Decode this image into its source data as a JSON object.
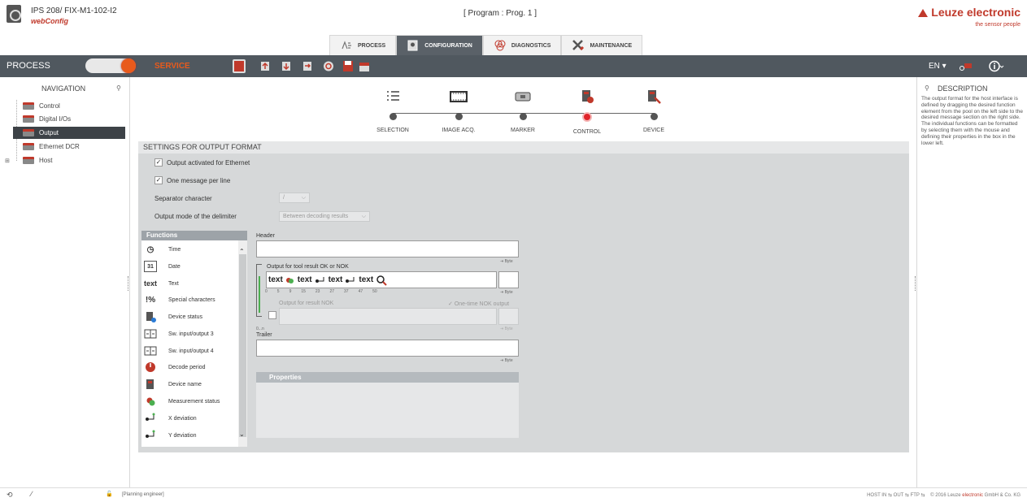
{
  "header": {
    "device_title": "IPS 208/ FIX-M1-102-I2",
    "app_name": "webConfig",
    "program": "[ Program : Prog. 1 ]",
    "brand": "Leuze electronic",
    "tagline": "the sensor people"
  },
  "tabs": [
    {
      "label": "PROCESS",
      "icon": "process-icon"
    },
    {
      "label": "CONFIGURATION",
      "icon": "configuration-icon",
      "active": true
    },
    {
      "label": "DIAGNOSTICS",
      "icon": "diagnostics-icon"
    },
    {
      "label": "MAINTENANCE",
      "icon": "maintenance-icon"
    }
  ],
  "toolbar": {
    "process_label": "PROCESS",
    "service_label": "SERVICE",
    "language": "EN",
    "accent": "#e85a1c"
  },
  "navigation": {
    "title": "NAVIGATION",
    "items": [
      {
        "label": "Control"
      },
      {
        "label": "Digital I/Os"
      },
      {
        "label": "Output",
        "selected": true
      },
      {
        "label": "Ethernet DCR"
      },
      {
        "label": "Host"
      }
    ]
  },
  "steps": [
    {
      "label": "SELECTION",
      "icon": "list-icon"
    },
    {
      "label": "IMAGE ACQ.",
      "icon": "film-icon"
    },
    {
      "label": "MARKER",
      "icon": "marker-icon"
    },
    {
      "label": "CONTROL",
      "icon": "control-icon",
      "current": true
    },
    {
      "label": "DEVICE",
      "icon": "device-icon"
    }
  ],
  "settings": {
    "title": "SETTINGS FOR OUTPUT FORMAT",
    "output_activated": "Output activated for Ethernet",
    "one_message": "One message per line",
    "separator_label": "Separator character",
    "separator_value": "/",
    "delimiter_label": "Output mode of the delimiter",
    "delimiter_value": "Between decoding results"
  },
  "functions": {
    "title": "Functions",
    "items": [
      {
        "label": "Time",
        "icon": "clock-icon"
      },
      {
        "label": "Date",
        "icon": "calendar-icon"
      },
      {
        "label": "Text",
        "icon": "text-icon"
      },
      {
        "label": "Special characters",
        "icon": "special-characters-icon"
      },
      {
        "label": "Device status",
        "icon": "device-status-icon"
      },
      {
        "label": "Sw. input/output 3",
        "icon": "switch-io-icon"
      },
      {
        "label": "Sw. input/output 4",
        "icon": "switch-io-icon"
      },
      {
        "label": "Decode period",
        "icon": "decode-period-icon"
      },
      {
        "label": "Device name",
        "icon": "device-name-icon"
      },
      {
        "label": "Measurement status",
        "icon": "measurement-status-icon"
      },
      {
        "label": "X deviation",
        "icon": "x-deviation-icon"
      },
      {
        "label": "Y deviation",
        "icon": "y-deviation-icon"
      }
    ]
  },
  "editor": {
    "header_label": "Header",
    "byte": "Byte",
    "ok_nok_label": "Output for tool result OK or NOK",
    "token_text": "text",
    "ruler": [
      "0",
      "5",
      "9",
      "15",
      "23",
      "27",
      "37",
      "47",
      "50"
    ],
    "nok_label": "Output for result NOK",
    "one_time_nok": "One-time NOK output",
    "range": "0...n",
    "trailer_label": "Trailer",
    "properties_label": "Properties"
  },
  "description": {
    "title": "DESCRIPTION",
    "text": "The output format for the host interface is defined by dragging the desired function element from the pool on the left side to the desired message section on the right side. The individual functions can be formatted by selecting them with the mouse and defining their properties in the box in the lower left."
  },
  "footer": {
    "user": "[Planning engineer]",
    "status": "HOST IN ⇆   OUT ⇆   FTP ⇆",
    "copyright_prefix": "© 2016 Leuze ",
    "copyright_brand": "electronic",
    "copyright_suffix": " GmbH & Co. KG"
  }
}
